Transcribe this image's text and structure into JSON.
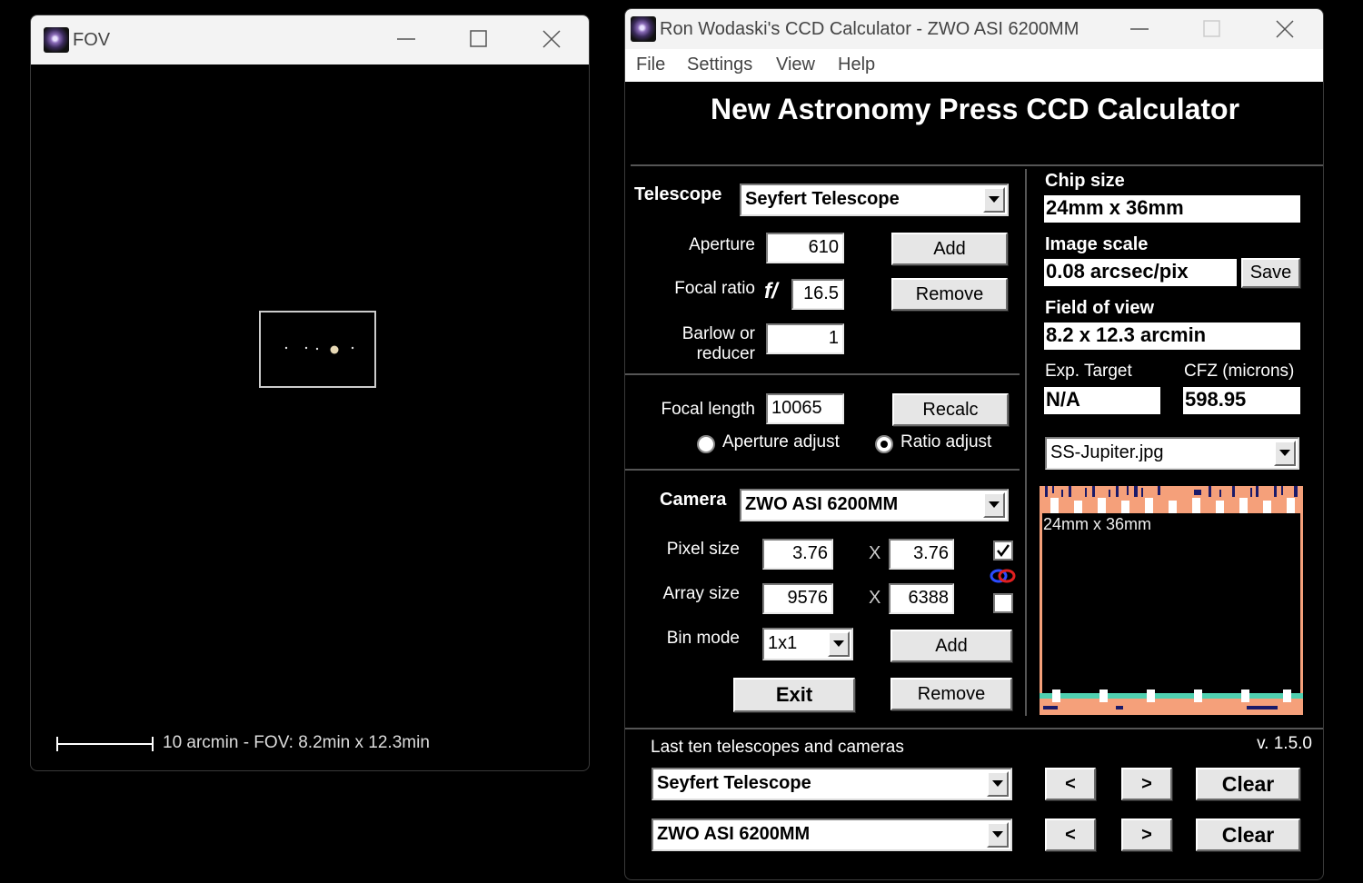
{
  "fov_window": {
    "title": "FOV",
    "scale_text": "10 arcmin - FOV: 8.2min x 12.3min"
  },
  "calc_window": {
    "title": "Ron Wodaski's CCD Calculator - ZWO ASI 6200MM",
    "menu": [
      "File",
      "Settings",
      "View",
      "Help"
    ],
    "heading": "New Astronomy Press CCD Calculator",
    "telescope": {
      "label": "Telescope",
      "selected": "Seyfert Telescope",
      "aperture_label": "Aperture",
      "aperture": "610",
      "focal_ratio_label": "Focal ratio",
      "f_symbol": "f/",
      "focal_ratio": "16.5",
      "barlow_label_1": "Barlow or",
      "barlow_label_2": "reducer",
      "barlow": "1",
      "add_label": "Add",
      "remove_label": "Remove"
    },
    "focal": {
      "label": "Focal length",
      "value": "10065",
      "recalc_label": "Recalc",
      "aperture_adjust_label": "Aperture adjust",
      "ratio_adjust_label": "Ratio adjust",
      "selected_mode": "ratio"
    },
    "camera": {
      "label": "Camera",
      "selected": "ZWO ASI 6200MM",
      "pixel_size_label": "Pixel size",
      "pixel_x": "3.76",
      "pixel_y": "3.76",
      "array_size_label": "Array size",
      "array_x": "9576",
      "array_y": "6388",
      "times": "X",
      "bin_mode_label": "Bin mode",
      "bin_mode": "1x1",
      "add_label": "Add",
      "remove_label": "Remove",
      "square_pixels_checked": true,
      "second_checked": false
    },
    "exit_label": "Exit",
    "results": {
      "chip_size_label": "Chip size",
      "chip_size": "24mm x 36mm",
      "image_scale_label": "Image scale",
      "image_scale": "0.08 arcsec/pix",
      "save_label": "Save",
      "fov_label": "Field of view",
      "fov": "8.2 x 12.3 arcmin",
      "exp_target_label": "Exp. Target",
      "exp_target": "N/A",
      "cfz_label": "CFZ (microns)",
      "cfz": "598.95",
      "image_select": "SS-Jupiter.jpg",
      "preview_label": "24mm x 36mm"
    },
    "recent": {
      "label": "Last ten telescopes and cameras",
      "version": "v. 1.5.0",
      "telescope": "Seyfert Telescope",
      "camera": "ZWO ASI 6200MM",
      "prev_label": "<",
      "next_label": ">",
      "clear_label": "Clear"
    },
    "colors": {
      "ruler_fill": "#f5a07a",
      "ruler_marks": "#1a1a6a",
      "ruler_bottom": "#4fd0b0",
      "preview_frame": "#f5a07a"
    }
  }
}
